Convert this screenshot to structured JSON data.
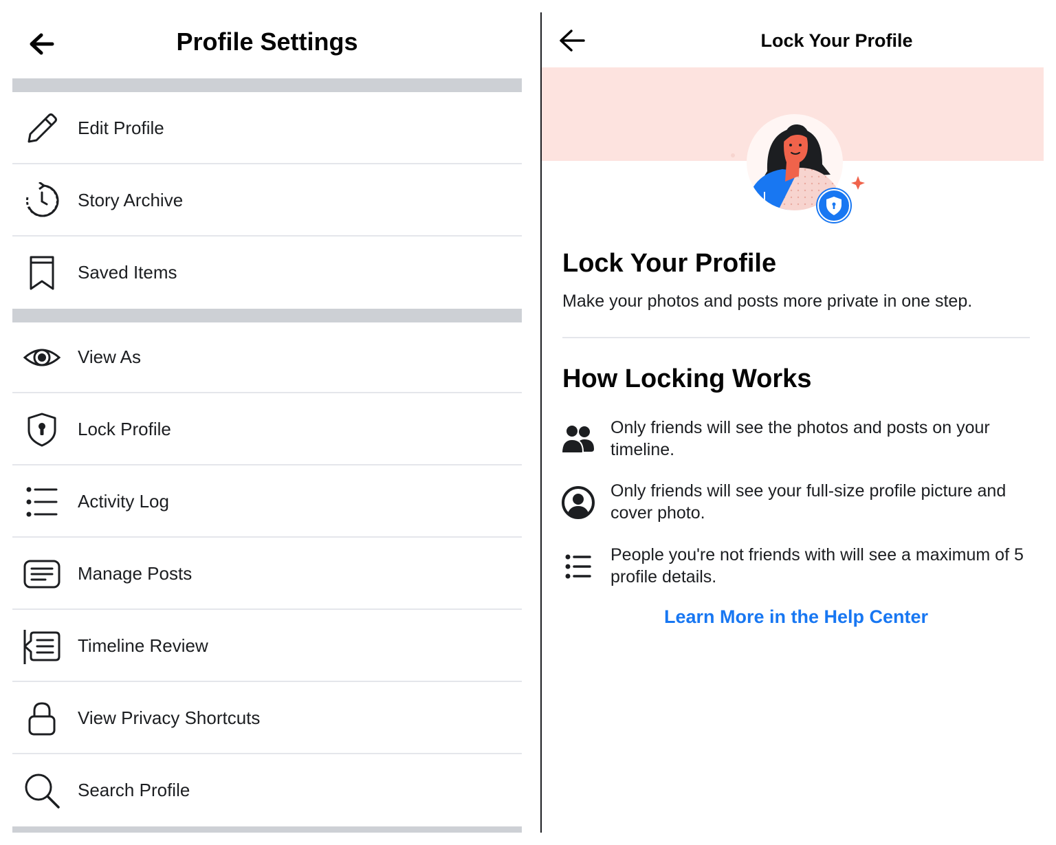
{
  "left": {
    "title": "Profile Settings",
    "back_icon": "arrow-left-icon",
    "menu": [
      {
        "label": "Edit Profile",
        "icon": "pencil-icon"
      },
      {
        "label": "Story Archive",
        "icon": "archive-clock-icon"
      },
      {
        "label": "Saved Items",
        "icon": "bookmark-icon"
      },
      {
        "label": "View As",
        "icon": "eye-icon"
      },
      {
        "label": "Lock Profile",
        "icon": "shield-lock-icon"
      },
      {
        "label": "Activity Log",
        "icon": "list-icon"
      },
      {
        "label": "Manage Posts",
        "icon": "posts-icon"
      },
      {
        "label": "Timeline Review",
        "icon": "timeline-review-icon"
      },
      {
        "label": "View Privacy Shortcuts",
        "icon": "lock-icon"
      },
      {
        "label": "Search Profile",
        "icon": "search-icon"
      }
    ]
  },
  "right": {
    "title": "Lock Your Profile",
    "back_icon": "arrow-left-icon",
    "heading": "Lock Your Profile",
    "subtitle": "Make your photos and posts more private in one step.",
    "how_heading": "How Locking Works",
    "rules": [
      {
        "text": "Only friends will see the photos and posts on your timeline.",
        "icon": "friends-icon"
      },
      {
        "text": "Only friends will see your full-size profile picture and cover photo.",
        "icon": "profile-circle-icon"
      },
      {
        "text": "People you're not friends with will see a maximum of 5 profile details.",
        "icon": "list-icon"
      }
    ],
    "help_link": "Learn More in the Help Center"
  },
  "colors": {
    "accent": "#1877f2",
    "hero_band": "#fde3df",
    "separator": "#cdd0d5"
  }
}
